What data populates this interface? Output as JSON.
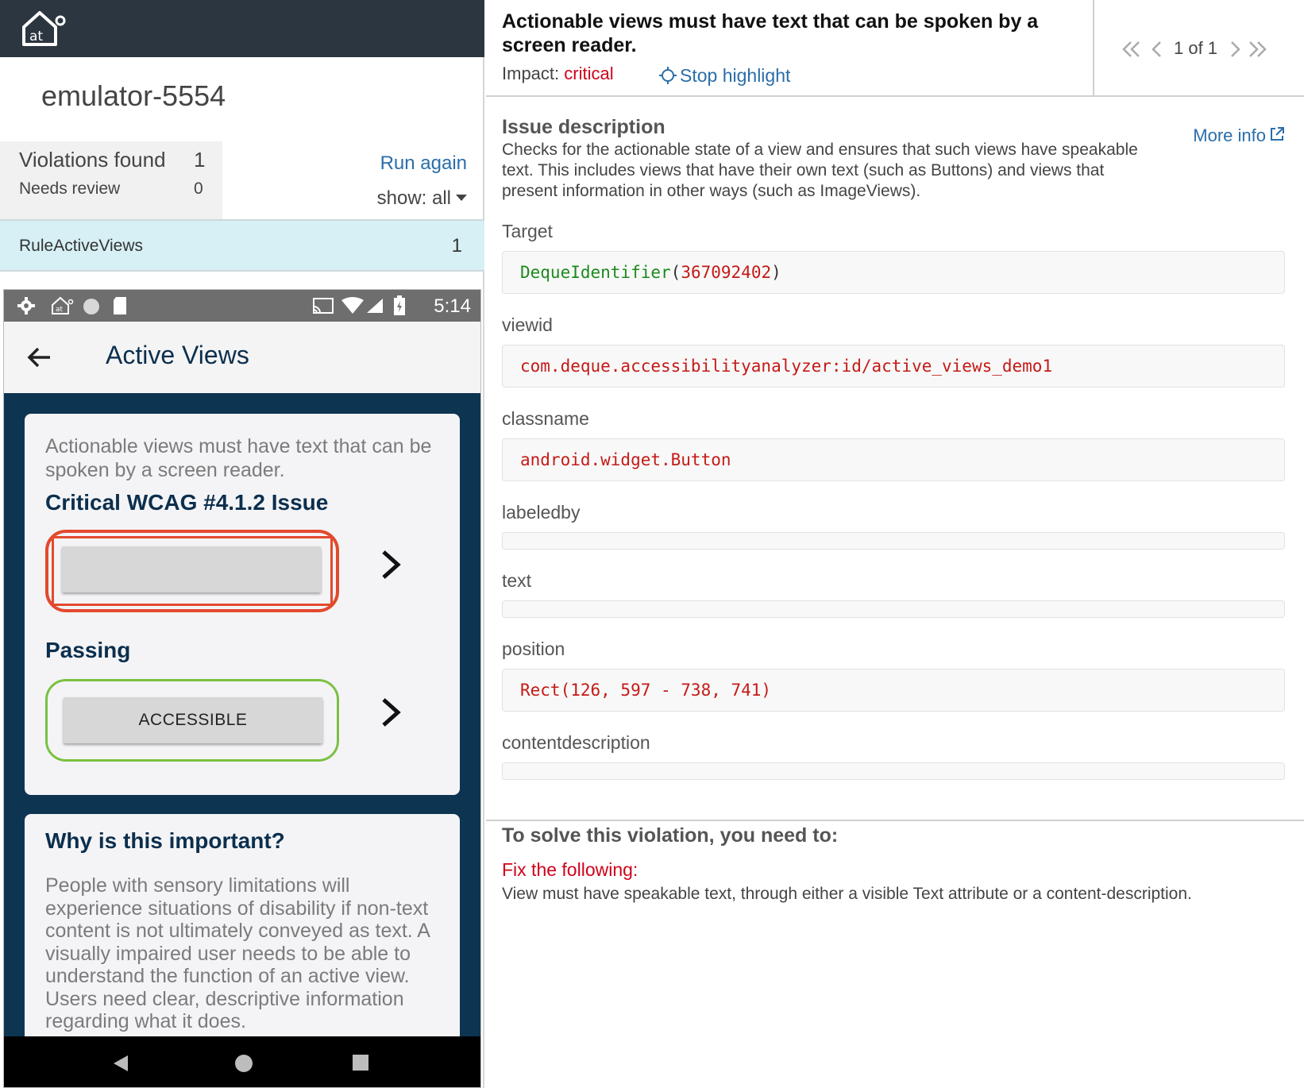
{
  "app": {
    "device_name": "emulator-5554"
  },
  "summary": {
    "violations_label": "Violations found",
    "violations_count": "1",
    "review_label": "Needs review",
    "review_count": "0",
    "run_again": "Run again",
    "show_filter": "show: all"
  },
  "rules": [
    {
      "name": "RuleActiveViews",
      "count": "1"
    }
  ],
  "phone": {
    "status_time": "5:14",
    "screen_title": "Active Views",
    "card1": {
      "intro": "Actionable views must have text that can be spoken by a screen reader.",
      "fail_heading": "Critical WCAG #4.1.2 Issue",
      "pass_heading": "Passing",
      "pass_button": "ACCESSIBLE"
    },
    "card2": {
      "heading": "Why is this important?",
      "body": "People with sensory limitations will experience situations of disability if non-text content is not ultimately conveyed as text. A visually impaired user needs to be able to understand the function of an active view. Users need clear, descriptive information regarding what it does."
    }
  },
  "issue": {
    "title": "Actionable views must have text that can be spoken by a screen reader.",
    "impact_label": "Impact:",
    "impact_value": "critical",
    "stop_highlight": "Stop highlight",
    "pager": "1 of 1",
    "description_title": "Issue description",
    "description": "Checks for the actionable state of a view and ensures that such views have speakable text. This includes views that have their own text (such as Buttons) and views that present information in other ways (such as ImageViews).",
    "more_info": "More info"
  },
  "fields": {
    "target_label": "Target",
    "target_fn": "DequeIdentifier",
    "target_arg": "367092402",
    "viewid_label": "viewid",
    "viewid_value": "com.deque.accessibilityanalyzer:id/active_views_demo1",
    "classname_label": "classname",
    "classname_value": "android.widget.Button",
    "labeledby_label": "labeledby",
    "labeledby_value": "",
    "text_label": "text",
    "text_value": "",
    "position_label": "position",
    "position_value": "Rect(126, 597 - 738, 741)",
    "contentdescription_label": "contentdescription",
    "contentdescription_value": ""
  },
  "solve": {
    "title": "To solve this violation, you need to:",
    "fix_label": "Fix the following:",
    "fix_text": "View must have speakable text, through either a visible Text attribute or a content-description."
  },
  "colors": {
    "accent_link": "#2a6ea8",
    "critical": "#d0021b",
    "fail_outline": "#e24a2d",
    "pass_outline": "#7ac142",
    "phone_bg": "#0d3552"
  }
}
